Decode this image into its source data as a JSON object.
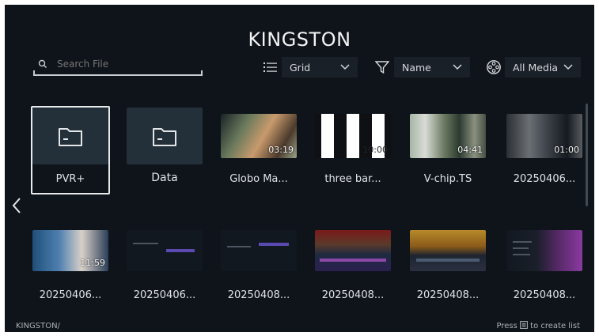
{
  "header": {
    "title": "KINGSTON"
  },
  "search": {
    "placeholder": "Search File"
  },
  "controls": {
    "view": "Grid",
    "sort": "Name",
    "filter": "All Media"
  },
  "grid": {
    "row1": [
      {
        "name": "PVR+"
      },
      {
        "name": "Data"
      },
      {
        "name": "Globo Ma...",
        "duration": "03:19"
      },
      {
        "name": "three bar...",
        "duration": "10:00"
      },
      {
        "name": "V-chip.TS",
        "duration": "04:41"
      },
      {
        "name": "20250406...",
        "duration": "01:00"
      }
    ],
    "row2": [
      {
        "name": "20250406...",
        "duration": "11:59"
      },
      {
        "name": "20250406..."
      },
      {
        "name": "20250408..."
      },
      {
        "name": "20250408..."
      },
      {
        "name": "20250408..."
      },
      {
        "name": "20250408..."
      }
    ]
  },
  "footer": {
    "path": "KINGSTON/",
    "hint_prefix": "Press",
    "hint_suffix": "to create list"
  }
}
